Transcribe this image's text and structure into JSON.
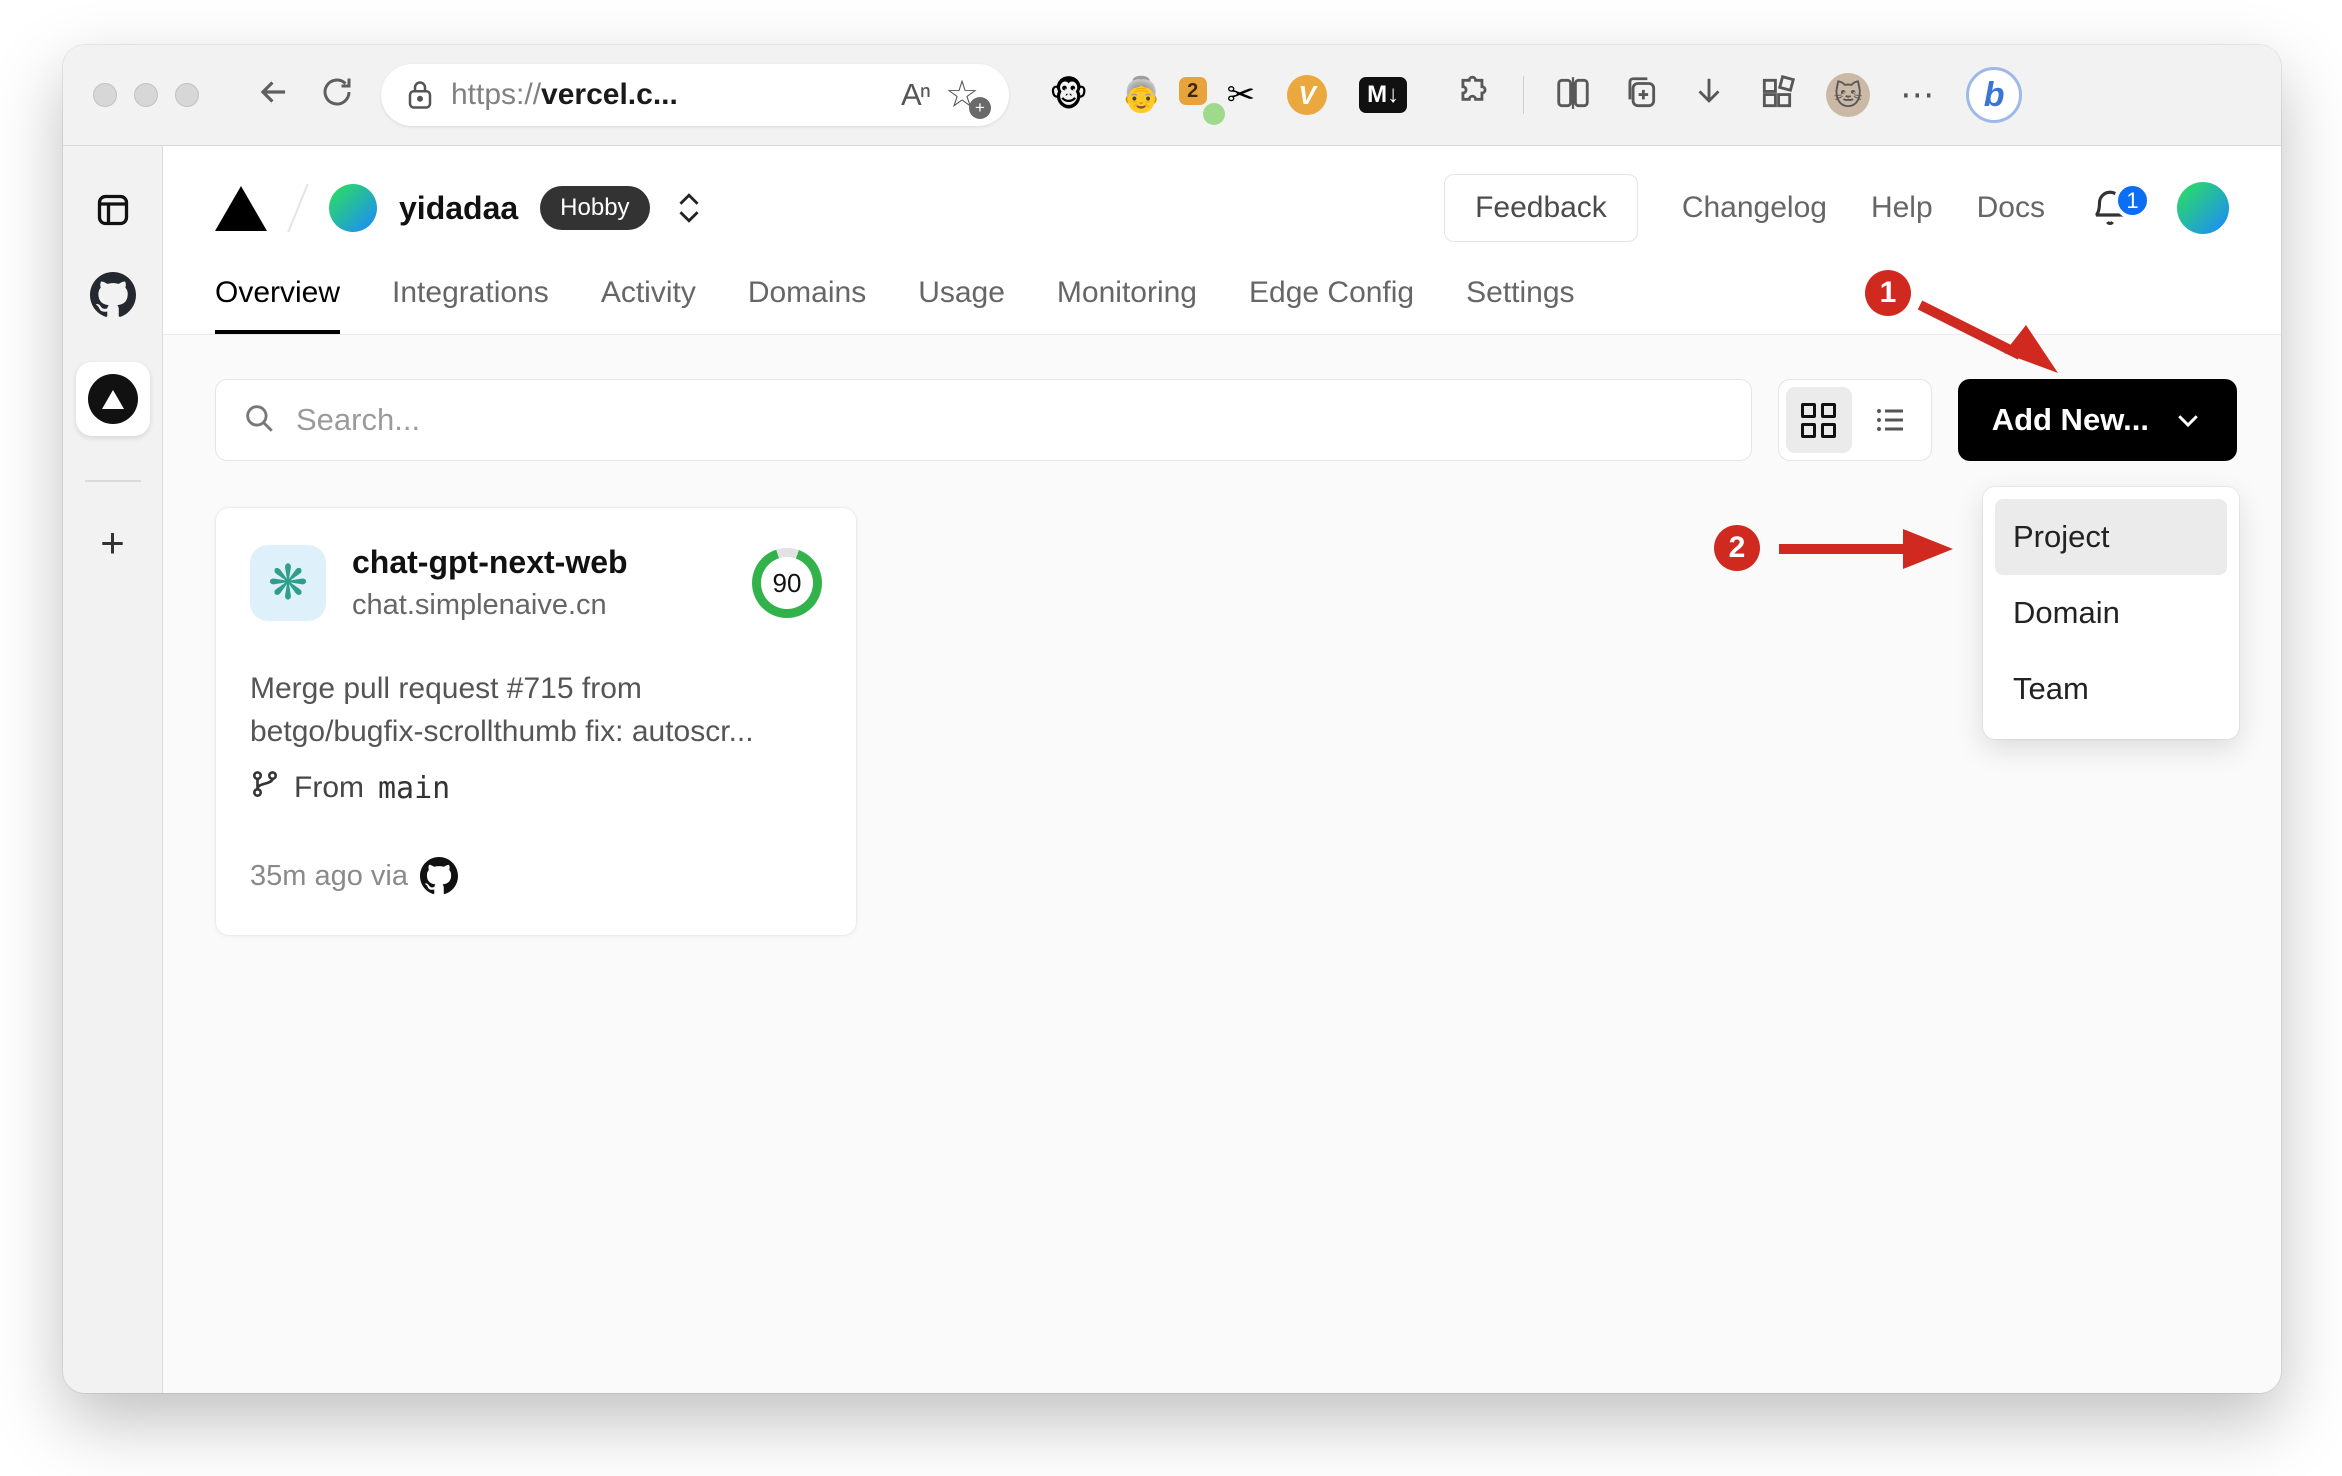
{
  "browser": {
    "url": {
      "scheme": "https://",
      "host": "vercel.c..."
    },
    "readaloud_label": "A",
    "extensions": {
      "badge_count": "2",
      "vimium_label": "V",
      "markdown_label": "M↓"
    },
    "menu_dots": "⋯",
    "bing_label": "b",
    "sidebar_plus": "+"
  },
  "vercel": {
    "team_name": "yidadaa",
    "plan_badge": "Hobby",
    "header_links": {
      "feedback": "Feedback",
      "changelog": "Changelog",
      "help": "Help",
      "docs": "Docs"
    },
    "notification_count": "1",
    "tabs": [
      {
        "label": "Overview"
      },
      {
        "label": "Integrations"
      },
      {
        "label": "Activity"
      },
      {
        "label": "Domains"
      },
      {
        "label": "Usage"
      },
      {
        "label": "Monitoring"
      },
      {
        "label": "Edge Config"
      },
      {
        "label": "Settings"
      }
    ],
    "search_placeholder": "Search...",
    "add_new_label": "Add New...",
    "dropdown_items": [
      {
        "label": "Project"
      },
      {
        "label": "Domain"
      },
      {
        "label": "Team"
      }
    ],
    "project_card": {
      "name": "chat-gpt-next-web",
      "domain": "chat.simplenaive.cn",
      "score": "90",
      "commit_line1": "Merge pull request #715 from",
      "commit_line2": "betgo/bugfix-scrollthumb fix: autoscr...",
      "branch_prefix": "From",
      "branch_name": "main",
      "deploy_meta": "35m ago via"
    }
  },
  "annotations": {
    "step1": "1",
    "step2": "2",
    "color": "#d02a20"
  }
}
